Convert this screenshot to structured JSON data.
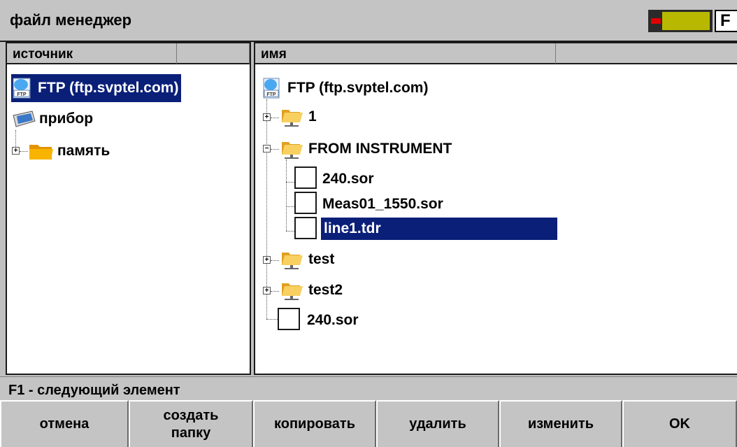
{
  "title": "файл менеджер",
  "fkey_label": "F",
  "left_panel": {
    "header": "источник",
    "items": [
      {
        "label": "FTP (ftp.svptel.com)",
        "selected": true
      },
      {
        "label": "прибор"
      },
      {
        "label": "память"
      }
    ]
  },
  "right_panel": {
    "header": "имя",
    "root": "FTP (ftp.svptel.com)",
    "ftp_icon_text": "FTP",
    "tree": [
      {
        "label": "1",
        "type": "folder"
      },
      {
        "label": "FROM INSTRUMENT",
        "type": "folder",
        "expanded": true
      },
      {
        "label": "240.sor",
        "type": "file"
      },
      {
        "label": "Meas01_1550.sor",
        "type": "file"
      },
      {
        "label": "line1.tdr",
        "type": "file",
        "selected": true
      },
      {
        "label": "test",
        "type": "folder"
      },
      {
        "label": "test2",
        "type": "folder"
      },
      {
        "label": "240.sor",
        "type": "file"
      }
    ]
  },
  "status_text": "F1 - следующий элемент",
  "buttons": {
    "cancel": "отмена",
    "create_folder_1": "создать",
    "create_folder_2": "папку",
    "copy": "копировать",
    "delete": "удалить",
    "modify": "изменить",
    "ok": "OK"
  },
  "colors": {
    "selection": "#0a1f78",
    "chrome": "#c4c4c4",
    "folder": "#f5a800"
  }
}
